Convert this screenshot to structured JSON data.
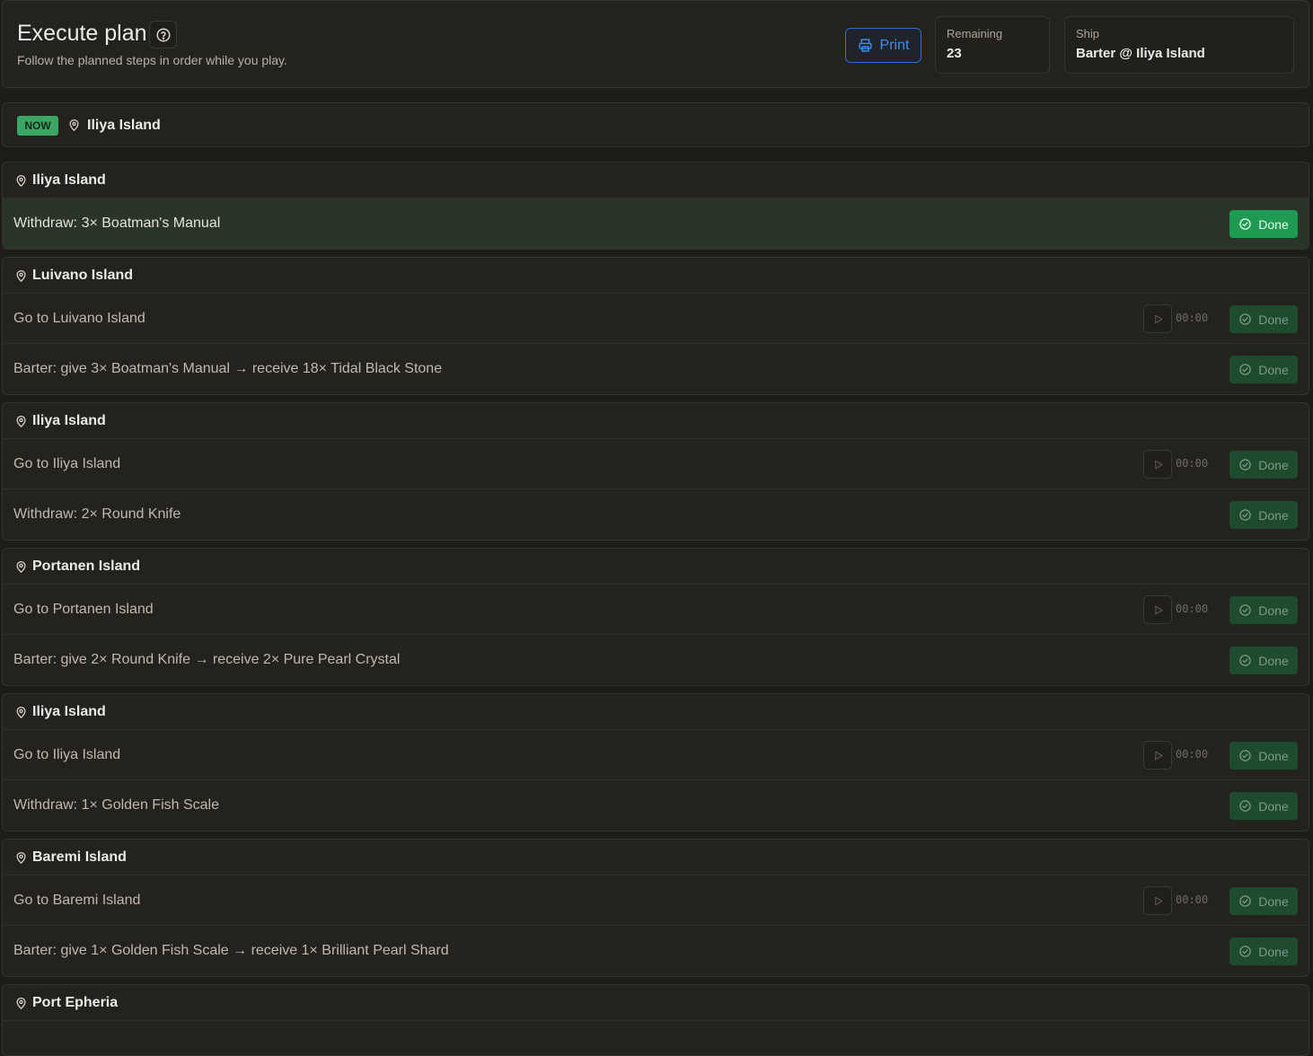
{
  "header": {
    "title": "Execute plan",
    "subtitle": "Follow the planned steps in order while you play.",
    "print_label": "Print",
    "remaining_label": "Remaining",
    "remaining_value": "23",
    "ship_label": "Ship",
    "ship_value": "Barter @ Iliya Island"
  },
  "now": {
    "badge": "NOW",
    "location": "Iliya Island"
  },
  "groups": [
    {
      "location": "Iliya Island",
      "steps": [
        {
          "text": "Withdraw: 3× Boatman's Manual",
          "timer": null,
          "done_label": "Done",
          "active": true
        }
      ]
    },
    {
      "location": "Luivano Island",
      "steps": [
        {
          "text": "Go to Luivano Island",
          "timer": "00:00",
          "done_label": "Done"
        },
        {
          "text": "Barter: give 3× Boatman's Manual → receive 18× Tidal Black Stone",
          "timer": null,
          "done_label": "Done"
        }
      ]
    },
    {
      "location": "Iliya Island",
      "steps": [
        {
          "text": "Go to Iliya Island",
          "timer": "00:00",
          "done_label": "Done"
        },
        {
          "text": "Withdraw: 2× Round Knife",
          "timer": null,
          "done_label": "Done"
        }
      ]
    },
    {
      "location": "Portanen Island",
      "steps": [
        {
          "text": "Go to Portanen Island",
          "timer": "00:00",
          "done_label": "Done"
        },
        {
          "text": "Barter: give 2× Round Knife → receive 2× Pure Pearl Crystal",
          "timer": null,
          "done_label": "Done"
        }
      ]
    },
    {
      "location": "Iliya Island",
      "steps": [
        {
          "text": "Go to Iliya Island",
          "timer": "00:00",
          "done_label": "Done"
        },
        {
          "text": "Withdraw: 1× Golden Fish Scale",
          "timer": null,
          "done_label": "Done"
        }
      ]
    },
    {
      "location": "Baremi Island",
      "steps": [
        {
          "text": "Go to Baremi Island",
          "timer": "00:00",
          "done_label": "Done"
        },
        {
          "text": "Barter: give 1× Golden Fish Scale → receive 1× Brilliant Pearl Shard",
          "timer": null,
          "done_label": "Done"
        }
      ]
    },
    {
      "location": "Port Epheria",
      "steps": []
    }
  ],
  "icons": {
    "help": "question-circle-icon",
    "print": "printer-icon",
    "location": "map-pin-icon",
    "done": "check-circle-icon",
    "play": "play-icon"
  },
  "colors": {
    "background": "#1d1c17",
    "panel": "#23221d",
    "accent_blue": "#3c8cf4",
    "done_active": "#1f9a52",
    "done_inactive": "#1e4a30",
    "now_badge": "#3aa564"
  }
}
